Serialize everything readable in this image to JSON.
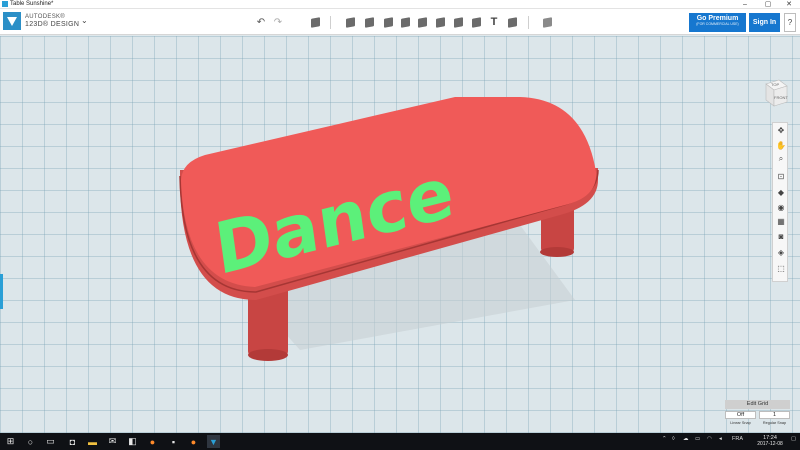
{
  "window": {
    "title": "Table Sunshine*",
    "minimize": "–",
    "maximize": "▢",
    "close": "✕"
  },
  "brand": {
    "line1": "AUTODESK®",
    "line2": "123D® DESIGN",
    "menu_caret": "⌄"
  },
  "toolbar": {
    "undo": "↶",
    "redo": "↷",
    "premium": {
      "label": "Go Premium",
      "sublabel": "(FOR COMMERCIAL USE)"
    },
    "signin": "Sign In",
    "help": "?"
  },
  "viewcube": {
    "top": "TOP",
    "front": "FRONT"
  },
  "model": {
    "engraved_text": "Dance",
    "table_color": "#f05a58",
    "text_color": "#5cf07a"
  },
  "edit_grid": {
    "title": "Edit Grid",
    "linear_snap_value": "Off",
    "linear_snap_label": "Linear Snap",
    "regular_snap_value": "1",
    "regular_snap_label": "Regular Snap"
  },
  "taskbar": {
    "language": "FRA",
    "time": "17:24",
    "date": "2017-12-08"
  },
  "colors": {
    "accent": "#1677cf",
    "grid": "#dce6ea",
    "taskbar": "#0f1115"
  }
}
